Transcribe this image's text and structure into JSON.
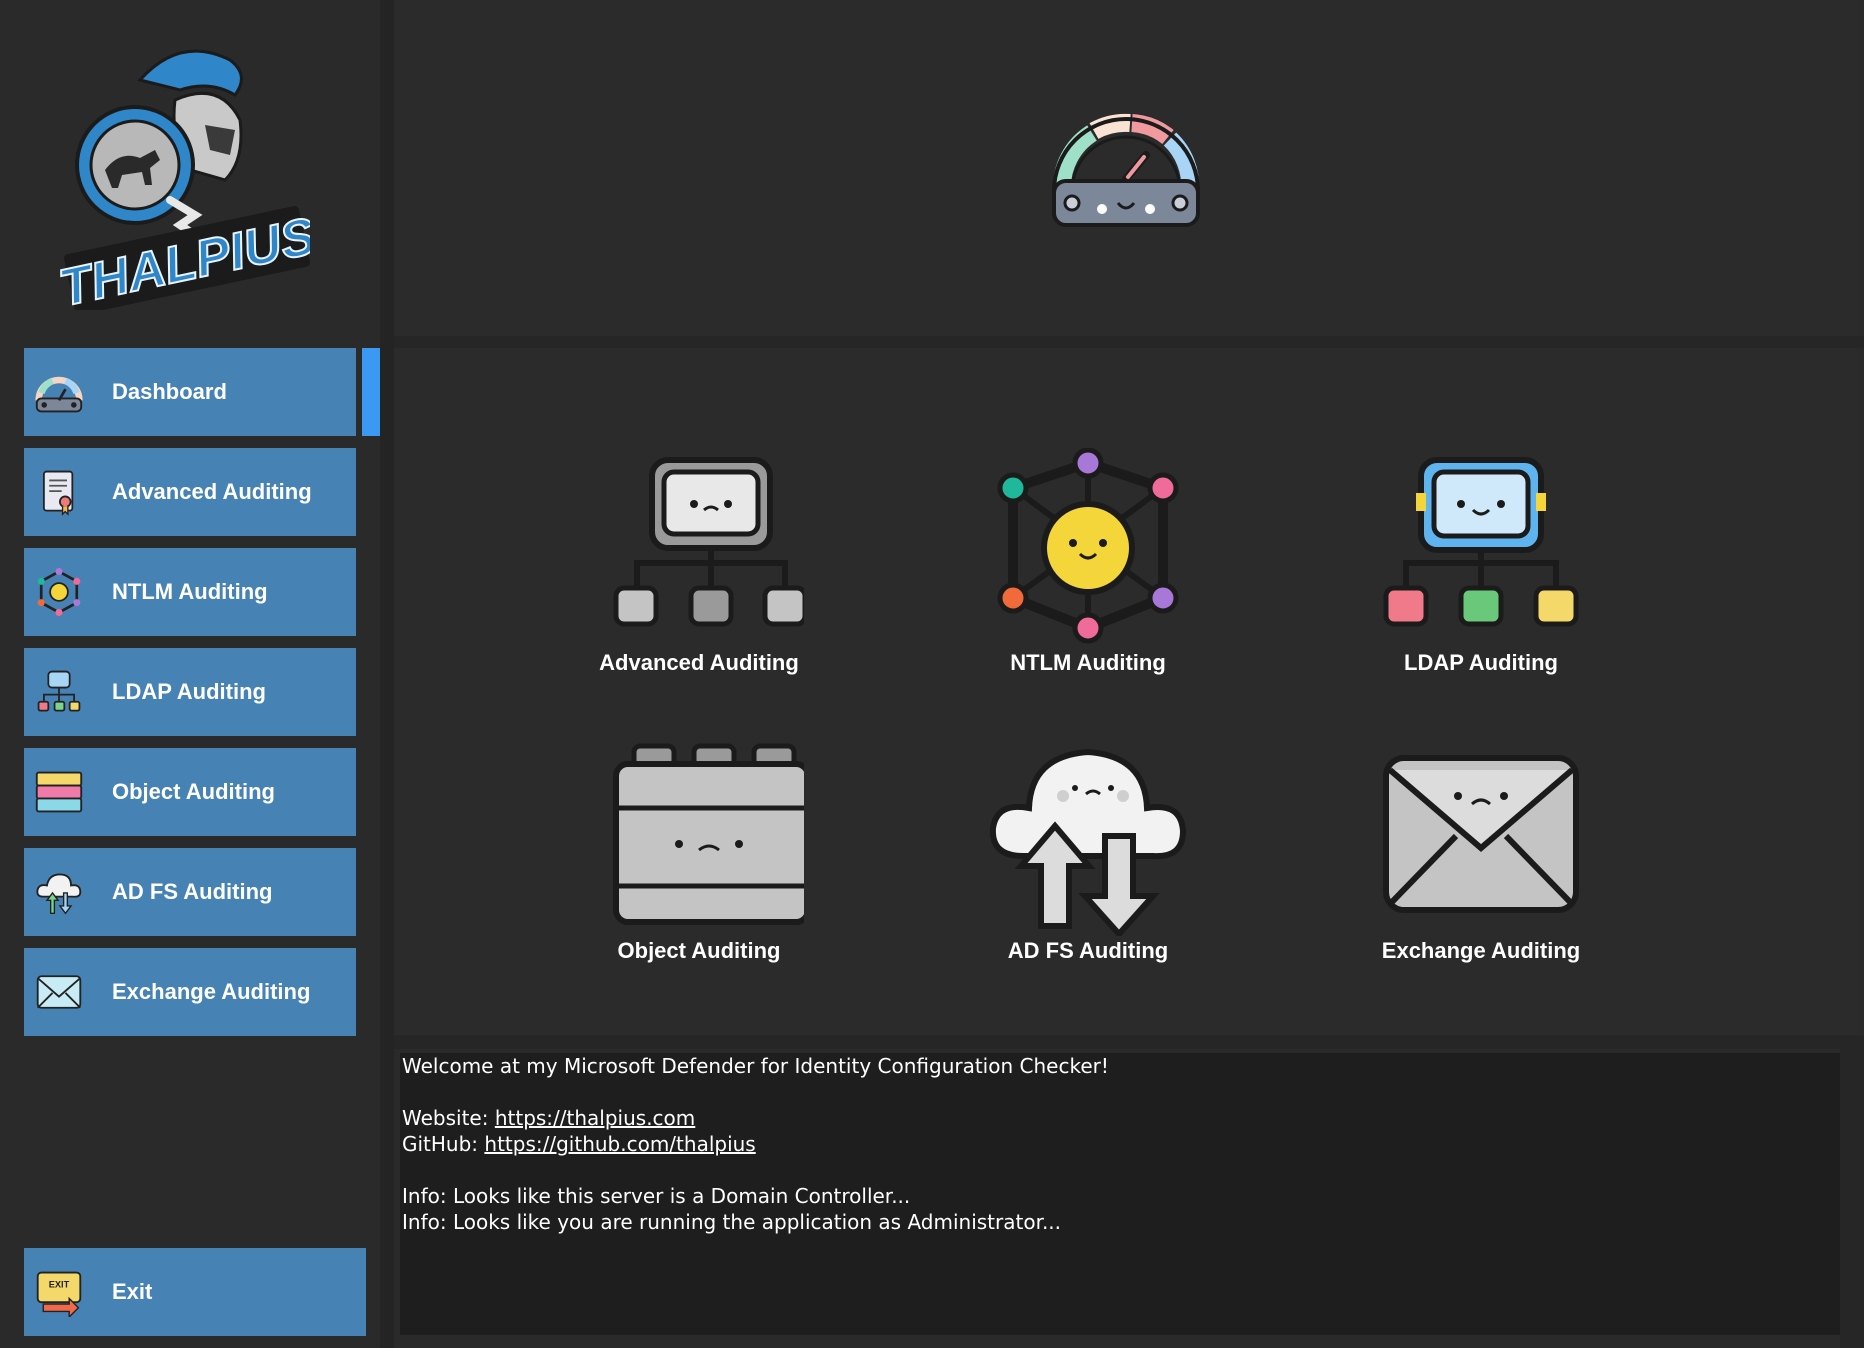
{
  "app": {
    "logo_text": "THALPIUS"
  },
  "sidebar": {
    "items": [
      {
        "label": "Dashboard",
        "icon": "gauge-icon"
      },
      {
        "label": "Advanced Auditing",
        "icon": "certificate-icon"
      },
      {
        "label": "NTLM Auditing",
        "icon": "network-hub-icon"
      },
      {
        "label": "LDAP Auditing",
        "icon": "hierarchy-icon"
      },
      {
        "label": "Object Auditing",
        "icon": "layers-icon"
      },
      {
        "label": "AD FS Auditing",
        "icon": "cloud-sync-icon"
      },
      {
        "label": "Exchange Auditing",
        "icon": "envelope-icon"
      }
    ],
    "exit_label": "Exit",
    "active_index": 0
  },
  "tiles": [
    {
      "label": "Advanced Auditing"
    },
    {
      "label": "NTLM Auditing"
    },
    {
      "label": "LDAP Auditing"
    },
    {
      "label": "Object Auditing"
    },
    {
      "label": "AD FS Auditing"
    },
    {
      "label": "Exchange Auditing"
    }
  ],
  "console": {
    "welcome": "Welcome at my Microsoft Defender for Identity Configuration Checker!",
    "website_prefix": "Website: ",
    "website_url": "https://thalpius.com",
    "github_prefix": "GitHub: ",
    "github_url": "https://github.com/thalpius",
    "info1": "Info: Looks like this server is a Domain Controller...",
    "info2": "Info: Looks like you are running the application as Administrator..."
  },
  "colors": {
    "accent": "#4682b4",
    "active_indicator": "#3c99f3",
    "background": "#2b2b2b",
    "console_bg": "#1e1e1e"
  }
}
